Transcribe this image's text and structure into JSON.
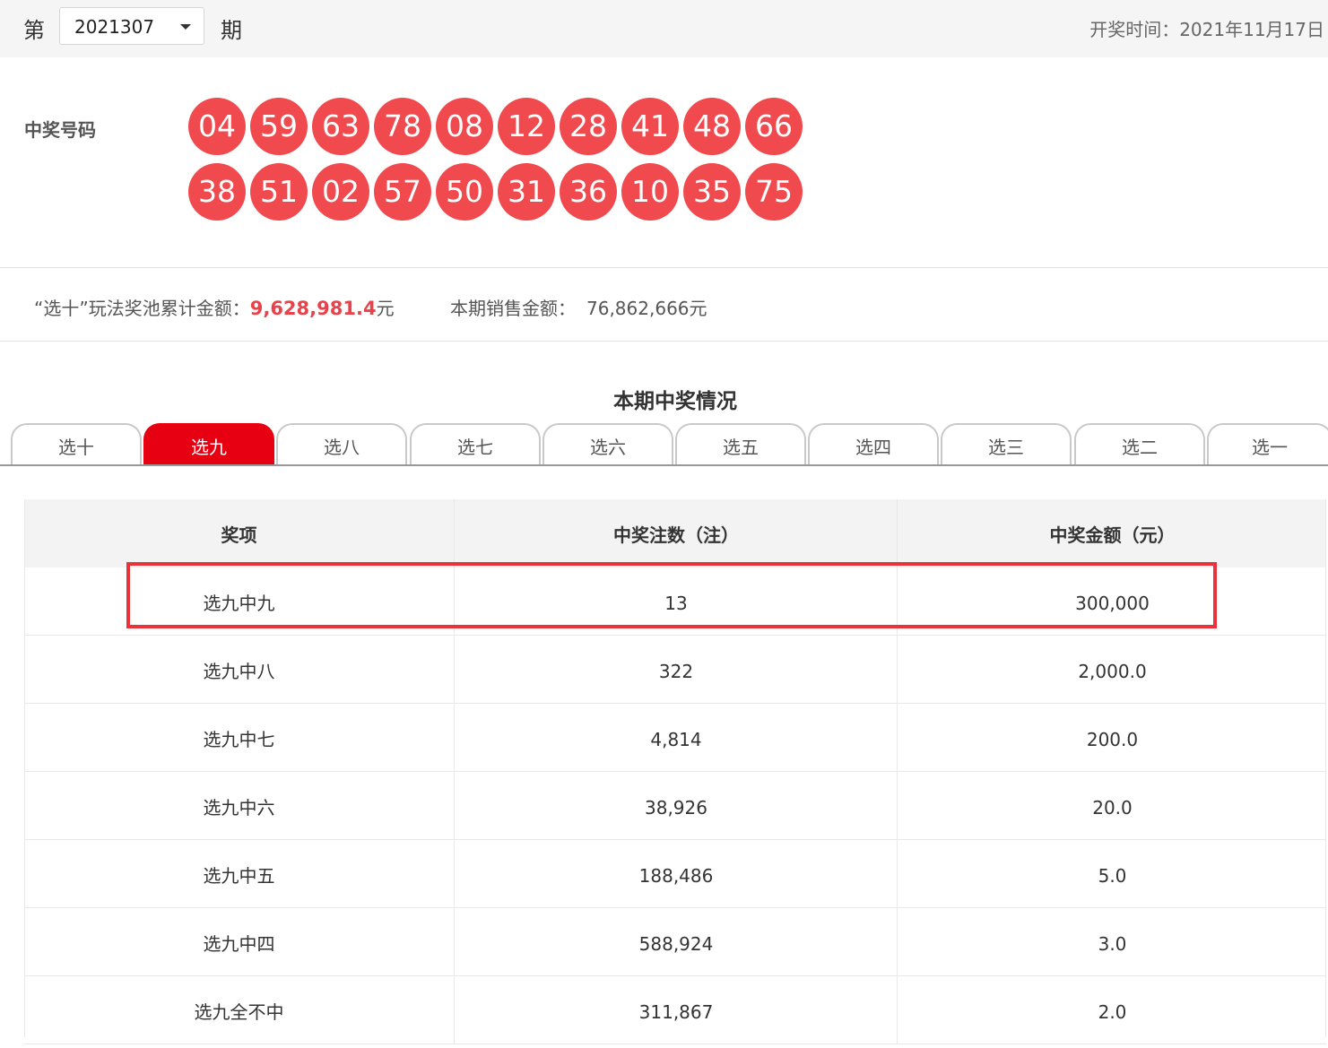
{
  "header": {
    "prefix": "第",
    "period": "2021307",
    "suffix": "期",
    "draw_time": "开奖时间：2021年11月17日"
  },
  "winning": {
    "label": "中奖号码",
    "numbers": [
      "04",
      "59",
      "63",
      "78",
      "08",
      "12",
      "28",
      "41",
      "48",
      "66",
      "38",
      "51",
      "02",
      "57",
      "50",
      "31",
      "36",
      "10",
      "35",
      "75"
    ],
    "ball_color": "#f04a4e"
  },
  "pool": {
    "label": "“选十”玩法奖池累计金额：",
    "amount": "9,628,981.4",
    "unit": "元",
    "sales_label": "本期销售金额：",
    "sales_value": "76,862,666元"
  },
  "section_title": "本期中奖情况",
  "tabs": [
    {
      "label": "选十",
      "active": false
    },
    {
      "label": "选九",
      "active": true
    },
    {
      "label": "选八",
      "active": false
    },
    {
      "label": "选七",
      "active": false
    },
    {
      "label": "选六",
      "active": false
    },
    {
      "label": "选五",
      "active": false
    },
    {
      "label": "选四",
      "active": false
    },
    {
      "label": "选三",
      "active": false
    },
    {
      "label": "选二",
      "active": false
    },
    {
      "label": "选一",
      "active": false
    }
  ],
  "table": {
    "headers": [
      "奖项",
      "中奖注数（注）",
      "中奖金额（元）"
    ],
    "rows": [
      [
        "选九中九",
        "13",
        "300,000"
      ],
      [
        "选九中八",
        "322",
        "2,000.0"
      ],
      [
        "选九中七",
        "4,814",
        "200.0"
      ],
      [
        "选九中六",
        "38,926",
        "20.0"
      ],
      [
        "选九中五",
        "188,486",
        "5.0"
      ],
      [
        "选九中四",
        "588,924",
        "3.0"
      ],
      [
        "选九全不中",
        "311,867",
        "2.0"
      ]
    ]
  },
  "accent_color": "#e60012"
}
